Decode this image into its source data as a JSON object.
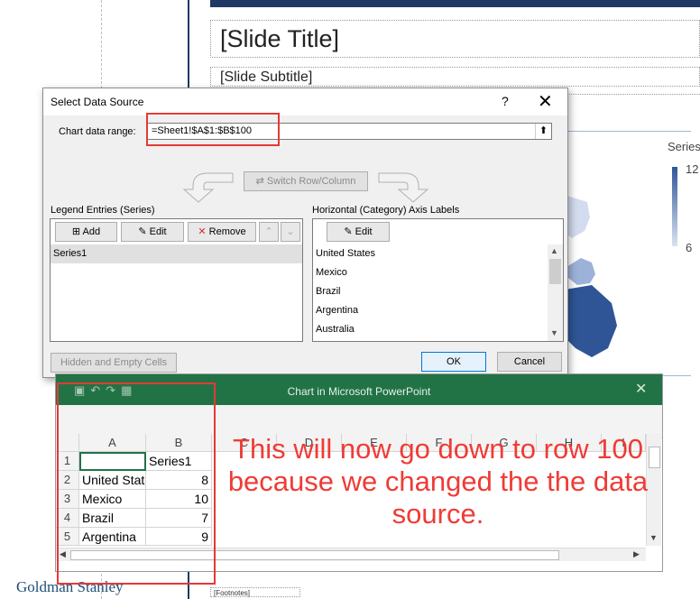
{
  "slide": {
    "title": "[Slide Title]",
    "subtitle": "[Slide Subtitle]",
    "footnotes": "[Footnotes]",
    "logo": "Goldman Stanley",
    "legend": {
      "title": "Series",
      "high": "12",
      "low": "6"
    }
  },
  "dialog": {
    "title": "Select Data Source",
    "help": "?",
    "close": "✕",
    "range_label": "Chart data range:",
    "range_value": "=Sheet1!$A$1:$B$100",
    "switch_label": "Switch Row/Column",
    "legend_group_label": "Legend Entries (Series)",
    "axis_group_label": "Horizontal (Category) Axis Labels",
    "legend_buttons": {
      "add": "Add",
      "edit": "Edit",
      "remove": "Remove"
    },
    "axis_edit": "Edit",
    "series": [
      "Series1"
    ],
    "categories": [
      "United States",
      "Mexico",
      "Brazil",
      "Argentina",
      "Australia"
    ],
    "hidden_cells_label": "Hidden and Empty Cells",
    "ok_label": "OK",
    "cancel_label": "Cancel"
  },
  "excel": {
    "title": "Chart in Microsoft PowerPoint",
    "close": "✕",
    "columns": [
      "A",
      "B",
      "C",
      "D",
      "E",
      "F",
      "G",
      "H",
      "I"
    ],
    "rows": [
      {
        "num": "1",
        "a": "",
        "b": "Series1"
      },
      {
        "num": "2",
        "a": "United States",
        "b": "8"
      },
      {
        "num": "3",
        "a": "Mexico",
        "b": "10"
      },
      {
        "num": "4",
        "a": "Brazil",
        "b": "7"
      },
      {
        "num": "5",
        "a": "Argentina",
        "b": "9"
      }
    ]
  },
  "annotation": "This will now go down to row 100 because we changed the the data source.",
  "colors": {
    "excel_green": "#217346",
    "annotation_red": "#ef3b36",
    "slide_navy": "#1f3864",
    "map_blue": "#2f5597"
  }
}
